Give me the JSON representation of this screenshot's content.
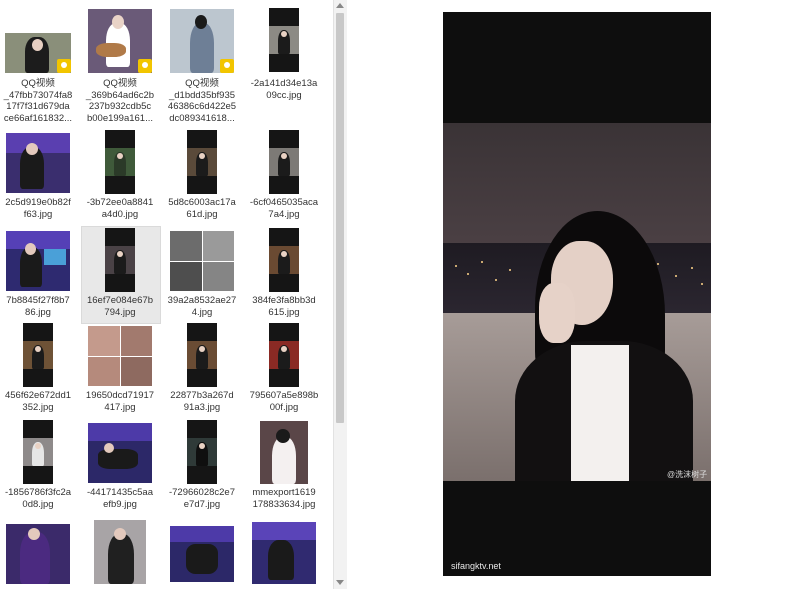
{
  "files": [
    {
      "name": "QQ视频\n_47fbb73074fa8\n17f7f31d679da\nce66af161832...",
      "kind": "video",
      "badge": "Player"
    },
    {
      "name": "QQ视频\n_369b64ad6c2b\n237b932cdb5c\nb00e199a161...",
      "kind": "video",
      "badge": "Player"
    },
    {
      "name": "QQ视频\n_d1bdd35bf935\n46386c6d422e5\ndc089341618...",
      "kind": "video",
      "badge": "Player"
    },
    {
      "name": "-2a141d34e13a\n09cc.jpg",
      "kind": "image"
    },
    {
      "name": "2c5d919e0b82f\nf63.jpg",
      "kind": "image"
    },
    {
      "name": "-3b72ee0a8841\na4d0.jpg",
      "kind": "image"
    },
    {
      "name": "5d8c6003ac17a\n61d.jpg",
      "kind": "image"
    },
    {
      "name": "-6cf0465035aca\n7a4.jpg",
      "kind": "image"
    },
    {
      "name": "7b8845f27f8b7\n86.jpg",
      "kind": "image"
    },
    {
      "name": "16ef7e084e67b\n794.jpg",
      "kind": "image",
      "selected": true
    },
    {
      "name": "39a2a8532ae27\n4.jpg",
      "kind": "image"
    },
    {
      "name": "384fe3fa8bb3d\n615.jpg",
      "kind": "image"
    },
    {
      "name": "456f62e672dd1\n352.jpg",
      "kind": "image"
    },
    {
      "name": "19650dcd71917\n417.jpg",
      "kind": "image"
    },
    {
      "name": "22877b3a267d\n91a3.jpg",
      "kind": "image"
    },
    {
      "name": "795607a5e898b\n00f.jpg",
      "kind": "image"
    },
    {
      "name": "-1856786f3fc2a\n0d8.jpg",
      "kind": "image"
    },
    {
      "name": "-44171435c5aa\nefb9.jpg",
      "kind": "image"
    },
    {
      "name": "-72966028c2e7\ne7d7.jpg",
      "kind": "image"
    },
    {
      "name": "mmexport1619\n178833634.jpg",
      "kind": "image"
    }
  ],
  "preview": {
    "weibo_mark": "@洗沫树子",
    "watermark": "sifangktv.net"
  },
  "colors": {
    "selection": "#e8e8e8",
    "badge": "#f2c500",
    "lips": "#c4141c"
  }
}
